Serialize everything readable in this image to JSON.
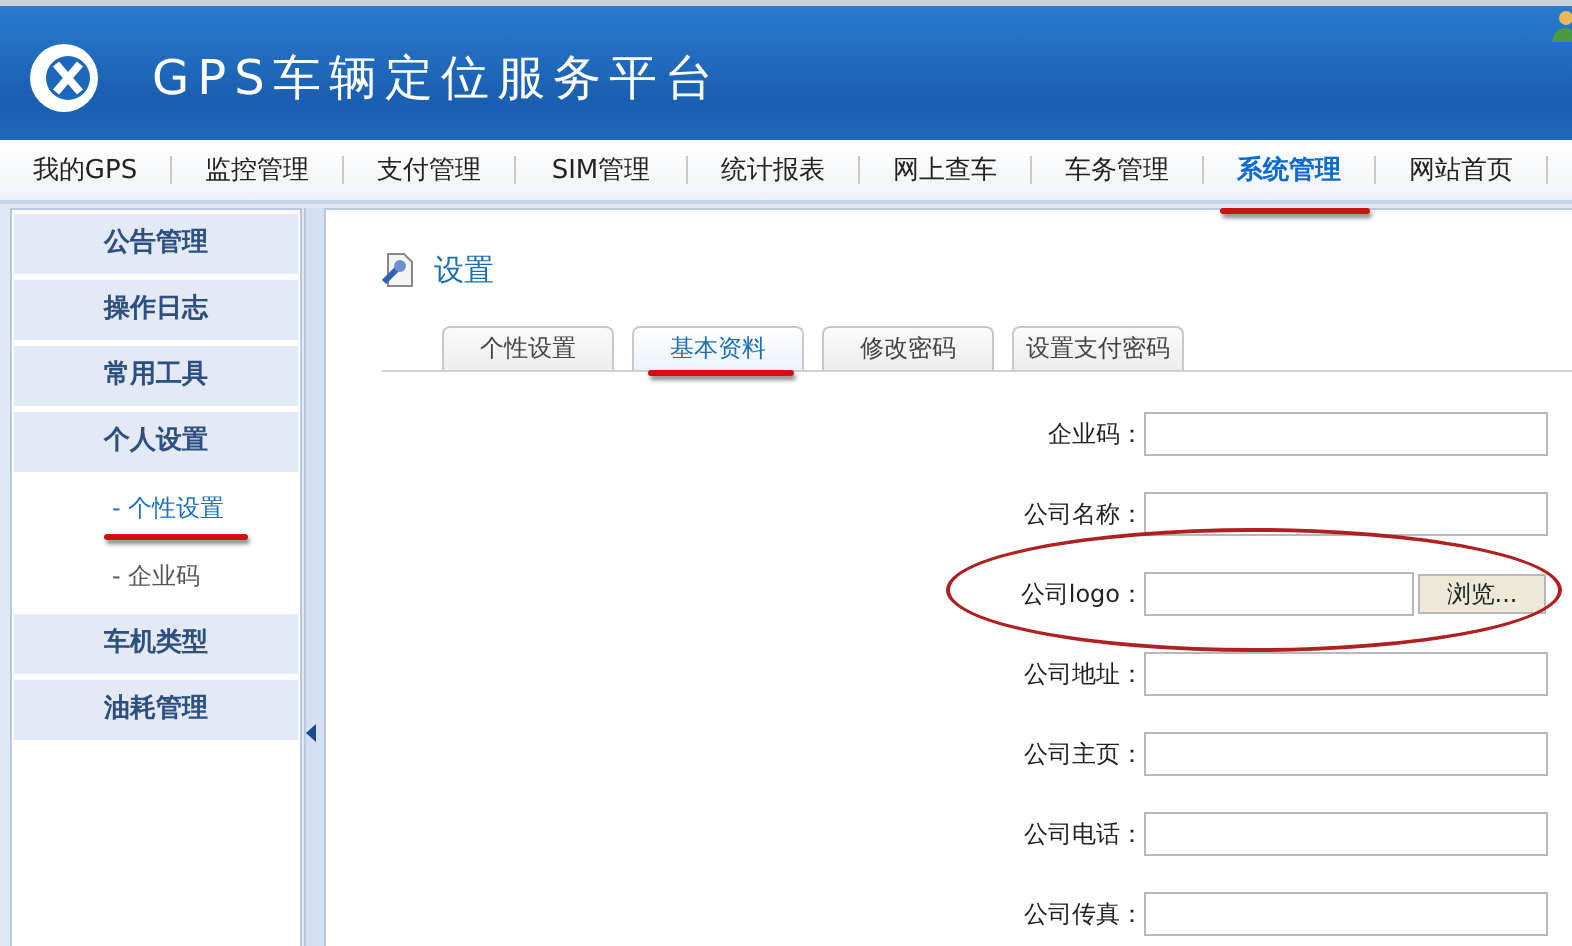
{
  "header": {
    "title": "GPS车辆定位服务平台"
  },
  "nav": [
    {
      "label": "我的GPS",
      "selected": false,
      "underlined": false
    },
    {
      "label": "监控管理",
      "selected": false,
      "underlined": false
    },
    {
      "label": "支付管理",
      "selected": false,
      "underlined": false
    },
    {
      "label": "SIM管理",
      "selected": false,
      "underlined": false
    },
    {
      "label": "统计报表",
      "selected": false,
      "underlined": false
    },
    {
      "label": "网上查车",
      "selected": false,
      "underlined": false
    },
    {
      "label": "车务管理",
      "selected": false,
      "underlined": false
    },
    {
      "label": "系统管理",
      "selected": true,
      "underlined": true
    },
    {
      "label": "网站首页",
      "selected": false,
      "underlined": false
    }
  ],
  "sidebar": {
    "items": [
      {
        "label": "公告管理",
        "kind": "group"
      },
      {
        "label": "操作日志",
        "kind": "group"
      },
      {
        "label": "常用工具",
        "kind": "group"
      },
      {
        "label": "个人设置",
        "kind": "group"
      },
      {
        "label": "- 个性设置",
        "kind": "sub",
        "selected": true,
        "underlined": true
      },
      {
        "label": "- 企业码",
        "kind": "sub",
        "selected": false,
        "underlined": false
      },
      {
        "label": "车机类型",
        "kind": "group"
      },
      {
        "label": "油耗管理",
        "kind": "group"
      }
    ]
  },
  "panel": {
    "title": "设置",
    "tabs": [
      {
        "label": "个性设置",
        "selected": false,
        "underlined": false
      },
      {
        "label": "基本资料",
        "selected": true,
        "underlined": true
      },
      {
        "label": "修改密码",
        "selected": false,
        "underlined": false
      },
      {
        "label": "设置支付密码",
        "selected": false,
        "underlined": false
      }
    ],
    "fields": [
      {
        "label": "企业码：",
        "kind": "text",
        "circled": false
      },
      {
        "label": "公司名称：",
        "kind": "text",
        "circled": false
      },
      {
        "label": "公司logo：",
        "kind": "file",
        "button": "浏览...",
        "circled": true
      },
      {
        "label": "公司地址：",
        "kind": "text",
        "circled": false
      },
      {
        "label": "公司主页：",
        "kind": "text",
        "circled": false
      },
      {
        "label": "公司电话：",
        "kind": "text",
        "circled": false
      },
      {
        "label": "公司传真：",
        "kind": "text",
        "circled": false
      }
    ]
  }
}
